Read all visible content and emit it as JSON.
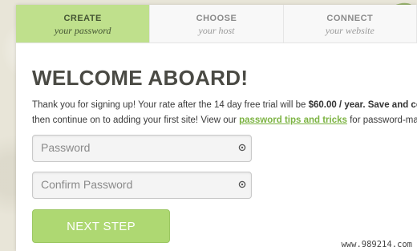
{
  "tabs": [
    {
      "title": "CREATE",
      "subtitle": "your password",
      "active": true
    },
    {
      "title": "CHOOSE",
      "subtitle": "your host",
      "active": false
    },
    {
      "title": "CONNECT",
      "subtitle": "your website",
      "active": false
    }
  ],
  "main": {
    "heading": "WELCOME ABOARD!",
    "intro": {
      "line1_text": "Thank you for signing up! Your rate after the 14 day free trial will be ",
      "line1_price": "$60.00 / year.",
      "line1_rest": " Save and conti",
      "line2_text": "then continue on to adding your first site! View our ",
      "line2_link": "password tips and tricks",
      "line2_rest": " for password-making"
    },
    "password_field": {
      "placeholder": "Password",
      "value": ""
    },
    "confirm_field": {
      "placeholder": "Confirm Password",
      "value": ""
    },
    "next_button": "NEXT STEP"
  },
  "watermark": "www.989214.com",
  "colors": {
    "accent_green": "#aed872",
    "active_tab": "#bfe08c",
    "link_green": "#7cb342",
    "heading": "#4a4a44"
  },
  "icons": {
    "field_icon": "key-icon",
    "decoration": "leaf-icon"
  }
}
